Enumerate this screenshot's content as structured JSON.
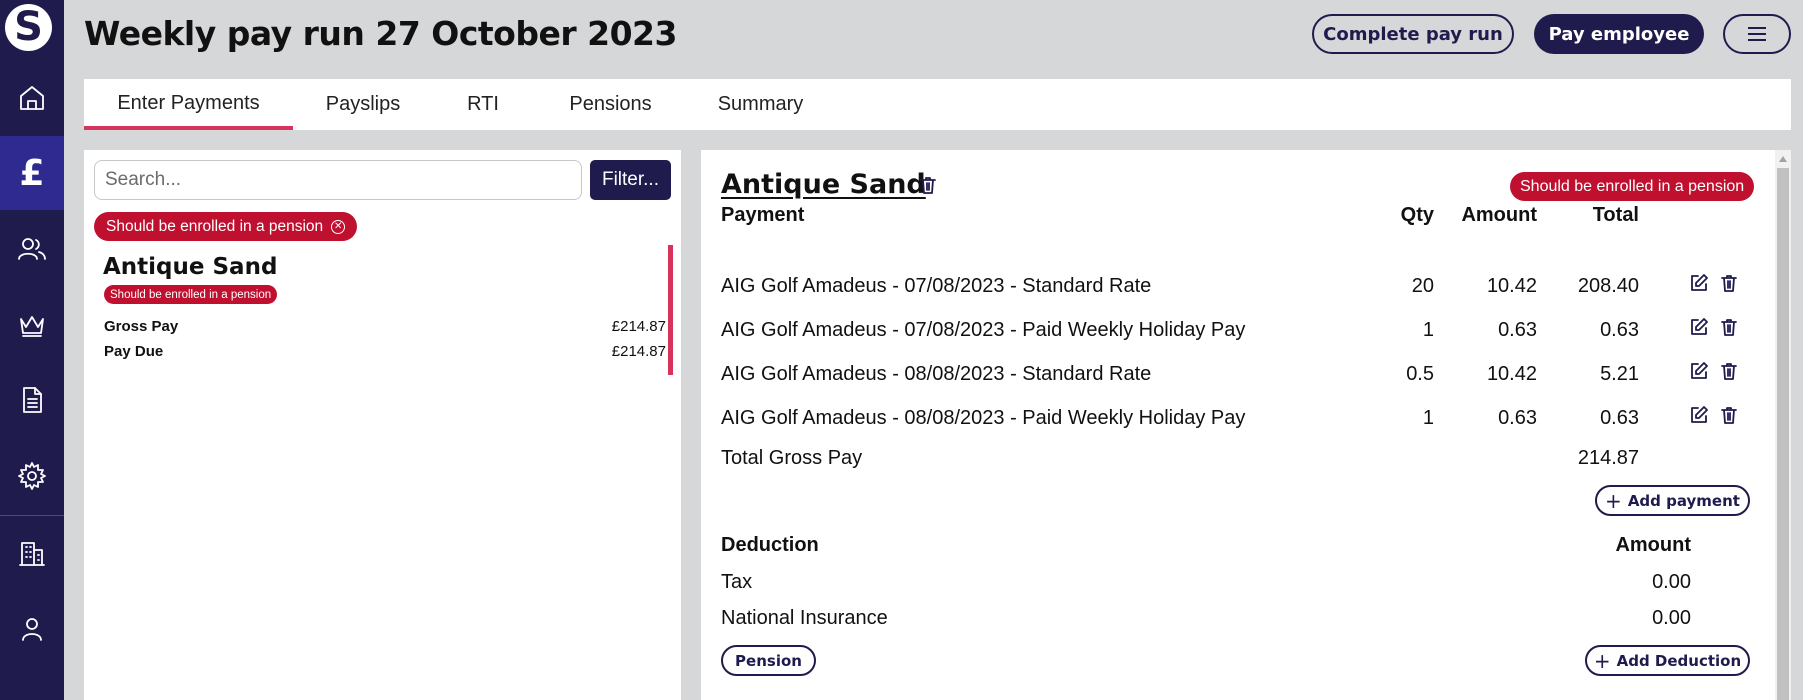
{
  "app": {
    "logo_letter": "S"
  },
  "header": {
    "title": "Weekly pay run 27 October 2023",
    "complete_label": "Complete pay run",
    "pay_label": "Pay employee"
  },
  "sidebar": {
    "items": [
      {
        "name": "home",
        "icon": "home-icon"
      },
      {
        "name": "payroll",
        "icon": "pound-icon",
        "glyph": "£",
        "active": true
      },
      {
        "name": "employees",
        "icon": "users-icon"
      },
      {
        "name": "crown",
        "icon": "crown-icon"
      },
      {
        "name": "documents",
        "icon": "document-icon"
      },
      {
        "name": "settings",
        "icon": "gear-icon"
      },
      {
        "name": "company",
        "icon": "building-icon"
      },
      {
        "name": "account",
        "icon": "user-icon"
      }
    ]
  },
  "tabs": [
    "Enter Payments",
    "Payslips",
    "RTI",
    "Pensions",
    "Summary"
  ],
  "left": {
    "search_placeholder": "Search...",
    "filter_label": "Filter...",
    "chip_label": "Should be enrolled in a pension",
    "employee": {
      "name": "Antique Sand",
      "badge": "Should be enrolled in a pension",
      "gross_label": "Gross Pay",
      "gross_value": "£214.87",
      "due_label": "Pay Due",
      "due_value": "£214.87"
    }
  },
  "detail": {
    "name": "Antique Sand",
    "badge": "Should be enrolled in a pension",
    "payments": {
      "headers": {
        "payment": "Payment",
        "qty": "Qty",
        "amount": "Amount",
        "total": "Total"
      },
      "rows": [
        {
          "desc": "AIG Golf Amadeus - 07/08/2023 - Standard Rate",
          "qty": "20",
          "amount": "10.42",
          "total": "208.40"
        },
        {
          "desc": "AIG Golf Amadeus - 07/08/2023 - Paid Weekly Holiday Pay",
          "qty": "1",
          "amount": "0.63",
          "total": "0.63"
        },
        {
          "desc": "AIG Golf Amadeus - 08/08/2023 - Standard Rate",
          "qty": "0.5",
          "amount": "10.42",
          "total": "5.21"
        },
        {
          "desc": "AIG Golf Amadeus - 08/08/2023 - Paid Weekly Holiday Pay",
          "qty": "1",
          "amount": "0.63",
          "total": "0.63"
        }
      ],
      "total_label": "Total Gross Pay",
      "total_value": "214.87",
      "add_label": "Add payment"
    },
    "deductions": {
      "headers": {
        "deduction": "Deduction",
        "amount": "Amount"
      },
      "rows": [
        {
          "label": "Tax",
          "amount": "0.00"
        },
        {
          "label": "National Insurance",
          "amount": "0.00"
        }
      ],
      "pension_label": "Pension",
      "add_label": "Add Deduction"
    }
  },
  "colors": {
    "navy": "#1f1b4d",
    "accent_pink": "#d6345a",
    "badge_red": "#c0102f",
    "background": "#d6d7d8"
  }
}
